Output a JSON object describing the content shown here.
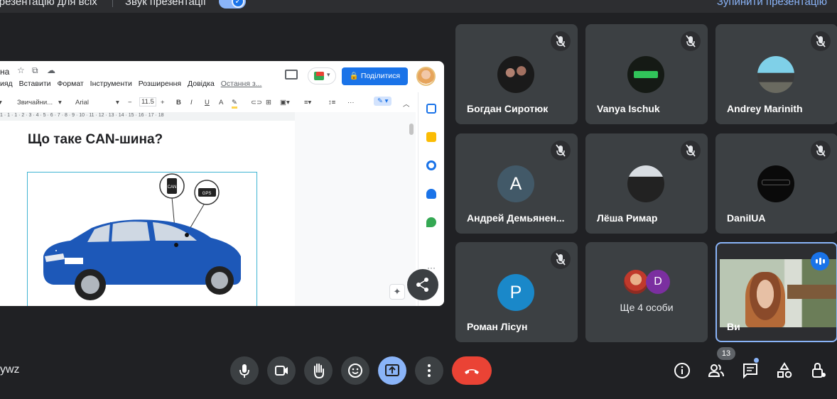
{
  "top_bar": {
    "present_for_all": "Презентацію для всіх",
    "present_sound": "Звук презентації",
    "stop_presenting": "Зупинити презентацію"
  },
  "docs": {
    "title_fragment": "на",
    "menu": [
      "ияд",
      "Вставити",
      "Формат",
      "Інструменти",
      "Розширення",
      "Довідка"
    ],
    "last_edit": "Остання з...",
    "share_label": "Поділитися",
    "toolbar": {
      "style": "Звичайни...",
      "font": "Arial",
      "size": "11.5"
    },
    "ruler": "1 · 1 · 1 · 2 · 3 · 4 · 5 · 6 · 7 · 8 · 9 · 10 · 11 · 12 · 13 · 14 · 15 · 16 · 17 · 18",
    "heading": "Що таке CAN-шина?",
    "image_labels": {
      "can": "CAN",
      "gps": "GPS"
    }
  },
  "participants": [
    {
      "name": "Богдан Сиротюк",
      "muted": true,
      "avatar": "photo"
    },
    {
      "name": "Vanya Ischuk",
      "muted": true,
      "avatar": "photo"
    },
    {
      "name": "Andrey Marinith",
      "muted": true,
      "avatar": "photo"
    },
    {
      "name": "Андрей Демьянен...",
      "muted": true,
      "avatar": "letter",
      "letter": "A",
      "color": "#425968"
    },
    {
      "name": "Лёша Римар",
      "muted": true,
      "avatar": "photo"
    },
    {
      "name": "DaniIUA",
      "muted": true,
      "avatar": "photo"
    },
    {
      "name": "Роман Лісун",
      "muted": true,
      "avatar": "letter",
      "letter": "P",
      "color": "#1a88c9"
    },
    {
      "name": "Ще 4 особи",
      "avatar_letter": "D",
      "avatar_color": "#7b2fa0"
    },
    {
      "name": "Ви",
      "self": true
    }
  ],
  "bottom_bar": {
    "meeting_code": "ywz",
    "participants_count": "13"
  }
}
